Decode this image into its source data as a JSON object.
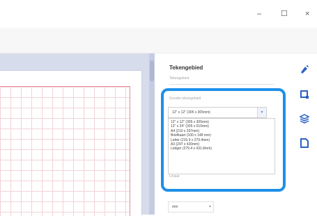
{
  "window": {
    "minimize_glyph": "–",
    "maximize_glyph": "☐",
    "close_glyph": "×"
  },
  "panel": {
    "title": "Tekengebied",
    "section_label": "Tekengebied",
    "size_label": "Grootte tekengebied",
    "selected_value": "12\" x 12\" (305 x 305mm)",
    "options": [
      "12\" x 12\" (305 x 305mm)",
      "12\" x 24\" (305 x 610mm)",
      "A4 (210 x 297mm)",
      "Briefkaart (100 x 148 mm)",
      "Letter (215.9 x 279.4mm)",
      "A3 (297 x 420mm)",
      "Ledger (279.4 x 431.8mm)"
    ],
    "lower_label": "Liniaal",
    "unit_value": "mm"
  },
  "colors": {
    "accent": "#1e8fe8",
    "icon": "#2b5fc4",
    "canvas_bg": "#d7dcec",
    "grid_line": "#e58b98"
  },
  "icons": [
    "pen-icon",
    "crop-icon",
    "layers-icon",
    "page-icon"
  ]
}
